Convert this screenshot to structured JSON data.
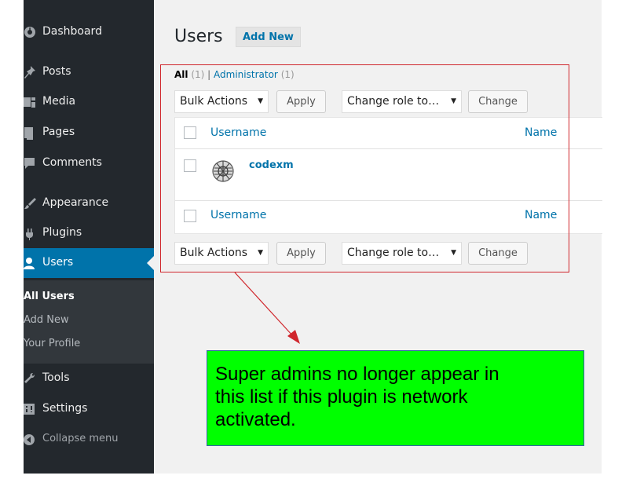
{
  "sidebar": {
    "items": [
      {
        "label": "Dashboard",
        "icon": "dashboard-icon"
      },
      {
        "label": "Posts",
        "icon": "pushpin-icon"
      },
      {
        "label": "Media",
        "icon": "media-icon"
      },
      {
        "label": "Pages",
        "icon": "page-icon"
      },
      {
        "label": "Comments",
        "icon": "comment-icon"
      },
      {
        "label": "Appearance",
        "icon": "paintbrush-icon"
      },
      {
        "label": "Plugins",
        "icon": "plugin-icon"
      },
      {
        "label": "Users",
        "icon": "user-icon"
      },
      {
        "label": "Tools",
        "icon": "wrench-icon"
      },
      {
        "label": "Settings",
        "icon": "settings-icon"
      },
      {
        "label": "Collapse menu",
        "icon": "collapse-icon"
      }
    ],
    "submenu": [
      "All Users",
      "Add New",
      "Your Profile"
    ],
    "active_color": "#0073aa"
  },
  "main": {
    "title": "Users",
    "add_new": "Add New",
    "views": {
      "all": "All",
      "all_count": "(1)",
      "separator": "|",
      "admin": "Administrator",
      "admin_count": "(1)"
    },
    "bulk_actions": "Bulk Actions",
    "apply": "Apply",
    "change_role": "Change role to…",
    "change": "Change",
    "columns": {
      "username": "Username",
      "name": "Name"
    },
    "user": {
      "username": "codexm"
    }
  },
  "annotation": {
    "note": "Super admins no longer appear in\nthis list if this plugin is network\nactivated.",
    "note_bg": "#00ff00",
    "outline_color": "#d0262c"
  }
}
